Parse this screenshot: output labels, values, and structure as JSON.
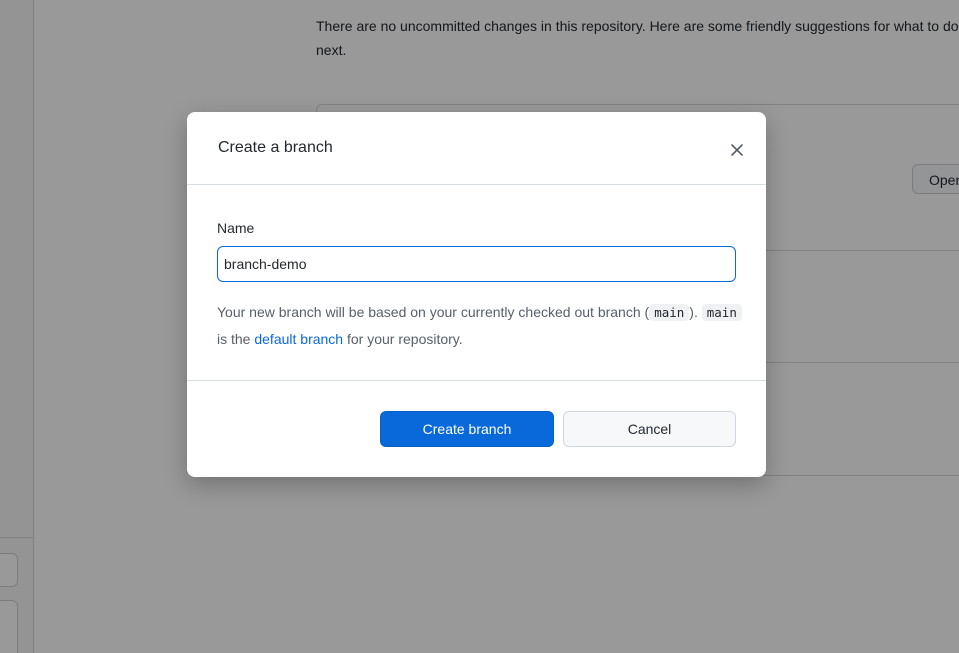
{
  "background": {
    "message": "There are no uncommitted changes in this repository. Here are some friendly suggestions for what to do next.",
    "open_button_label": "Open"
  },
  "dialog": {
    "title": "Create a branch",
    "close_icon": "close-icon",
    "name_label": "Name",
    "name_value": "branch-demo",
    "help": {
      "part1": "Your new branch will be based on your currently checked out branch (",
      "current_branch": "main",
      "part2": "). ",
      "default_branch_name": "main",
      "part3": " is the ",
      "link_text": "default branch",
      "part4": " for your repository."
    },
    "primary_button": "Create branch",
    "cancel_button": "Cancel"
  },
  "colors": {
    "accent": "#0969da",
    "overlay": "rgba(0,0,0,0.4)"
  }
}
